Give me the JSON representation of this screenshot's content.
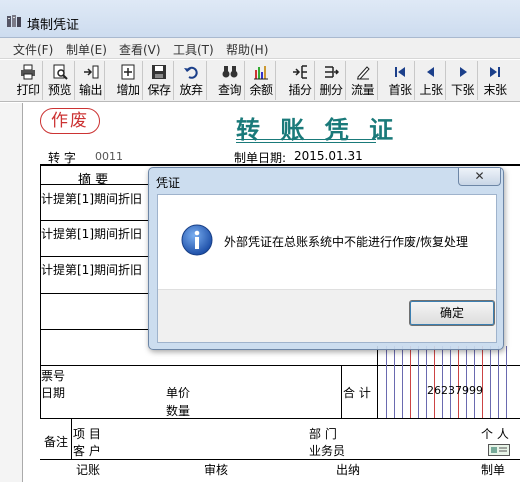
{
  "window": {
    "title": "填制凭证",
    "icon": "ledger-icon"
  },
  "menu": [
    "文件(F)",
    "制单(E)",
    "查看(V)",
    "工具(T)",
    "帮助(H)"
  ],
  "toolbar": [
    {
      "label": "打印",
      "icon": "printer-icon"
    },
    {
      "label": "预览",
      "icon": "preview-icon"
    },
    {
      "label": "输出",
      "icon": "export-icon"
    },
    {
      "label": "增加",
      "icon": "add-icon"
    },
    {
      "label": "保存",
      "icon": "save-icon"
    },
    {
      "label": "放弃",
      "icon": "undo-icon"
    },
    {
      "label": "查询",
      "icon": "binoculars-icon"
    },
    {
      "label": "余额",
      "icon": "bar-chart-icon"
    },
    {
      "label": "插分",
      "icon": "insert-row-icon"
    },
    {
      "label": "删分",
      "icon": "delete-row-icon"
    },
    {
      "label": "流量",
      "icon": "pen-icon"
    },
    {
      "label": "首张",
      "icon": "first-icon"
    },
    {
      "label": "上张",
      "icon": "previous-icon"
    },
    {
      "label": "下张",
      "icon": "next-icon"
    },
    {
      "label": "末张",
      "icon": "last-icon"
    }
  ],
  "voucher": {
    "stamp": "作废",
    "title": "转 账 凭 证",
    "type_label": "转 字",
    "number": "0011",
    "date_label": "制单日期:",
    "date": "2015.01.31",
    "summary_header": "摘 要",
    "rows": [
      "计提第[1]期间折旧",
      "计提第[1]期间折旧",
      "计提第[1]期间折旧"
    ],
    "ticket_no": "票号",
    "ticket_date": "日期",
    "unit_price": "单价",
    "quantity": "数量",
    "total_label": "合 计",
    "total_amount": "26237999",
    "remark": "备注",
    "project": "项 目",
    "customer": "客 户",
    "department": "部 门",
    "salesperson": "业务员",
    "individual": "个 人",
    "bookkeeper": "记账",
    "reviewer": "审核",
    "cashier": "出纳",
    "maker": "制单"
  },
  "dialog": {
    "title": "凭证",
    "message": "外部凭证在总账系统中不能进行作废/恢复处理",
    "ok": "确定",
    "icon": "info-icon"
  },
  "colors": {
    "accent": "#1a7a7a",
    "stamp": "#cc3333",
    "amount_lines": "#6a6ab0"
  }
}
